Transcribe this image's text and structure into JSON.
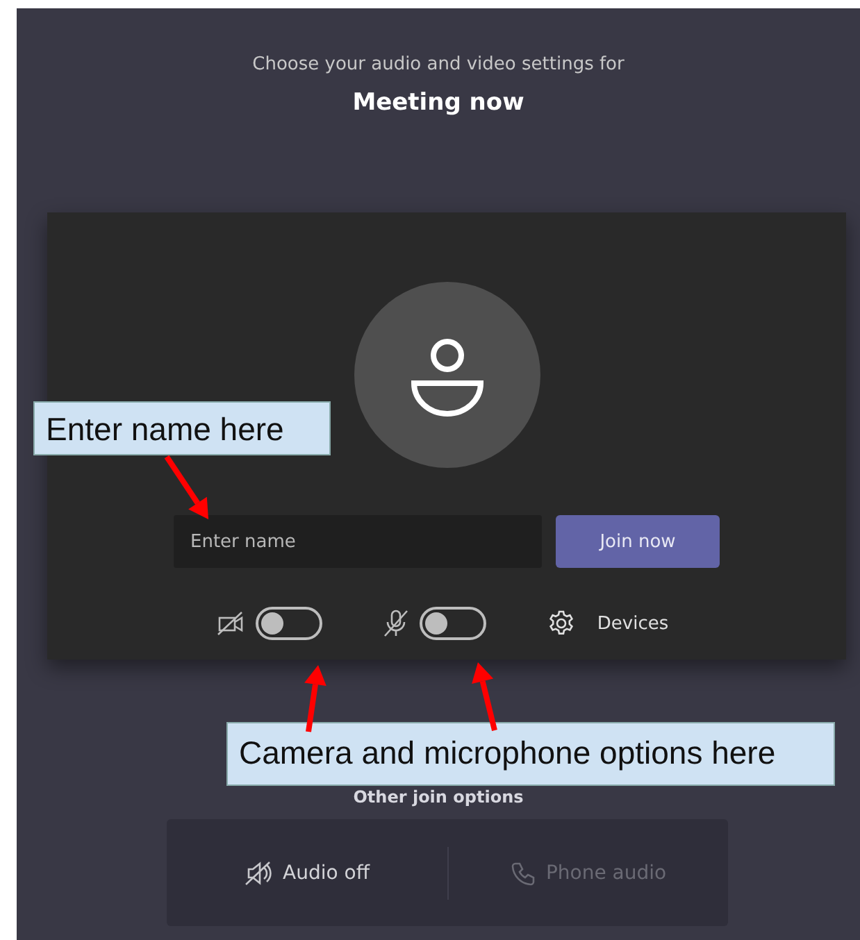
{
  "header": {
    "subtitle": "Choose your audio and video settings for",
    "title": "Meeting now"
  },
  "name_field": {
    "placeholder": "Enter name"
  },
  "join_button": "Join now",
  "toggles": [
    {
      "kind": "camera",
      "on": false
    },
    {
      "kind": "microphone",
      "on": false
    }
  ],
  "devices": "Devices",
  "other_join_options": {
    "title": "Other join options",
    "options": [
      {
        "kind": "audio-off",
        "label": "Audio off",
        "disabled": false
      },
      {
        "kind": "phone",
        "label": "Phone audio",
        "disabled": true
      }
    ]
  },
  "callouts": [
    {
      "text": "Enter name here"
    },
    {
      "text": "Camera and microphone options here"
    }
  ]
}
